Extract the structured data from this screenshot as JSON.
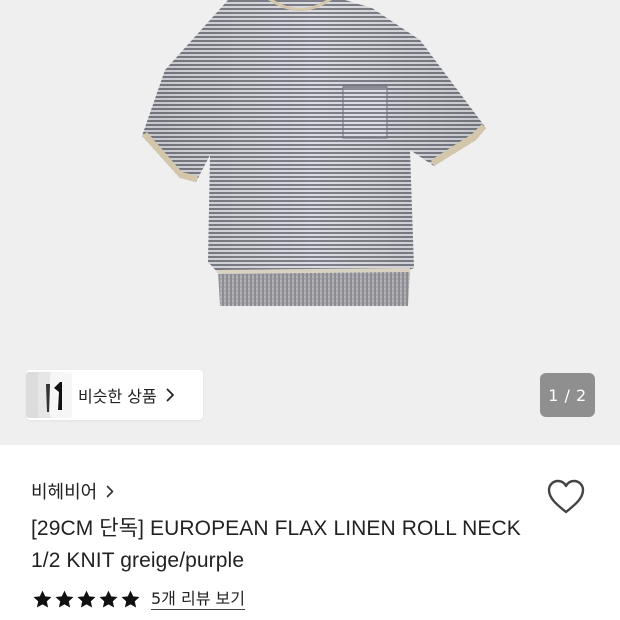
{
  "product_image": {
    "description_icon": "knit-tshirt-photo",
    "background": "#efefef",
    "stripe_colors": [
      "#7d7d86",
      "#dadbe2"
    ],
    "trim_color": "#d3c6ab"
  },
  "similar_products": {
    "label": "비슷한 상품",
    "icon": "chevron-right-icon"
  },
  "gallery": {
    "counter": "1 / 2"
  },
  "brand": {
    "name": "비헤비어",
    "icon": "chevron-right-icon"
  },
  "wishlist": {
    "icon": "heart-outline-icon"
  },
  "product": {
    "title_line1": "[29CM 단독] EUROPEAN FLAX LINEN ROLL NECK",
    "title_line2": "1/2 KNIT greige/purple"
  },
  "rating": {
    "stars": 5,
    "max_stars": 5,
    "review_link": "5개 리뷰 보기"
  }
}
